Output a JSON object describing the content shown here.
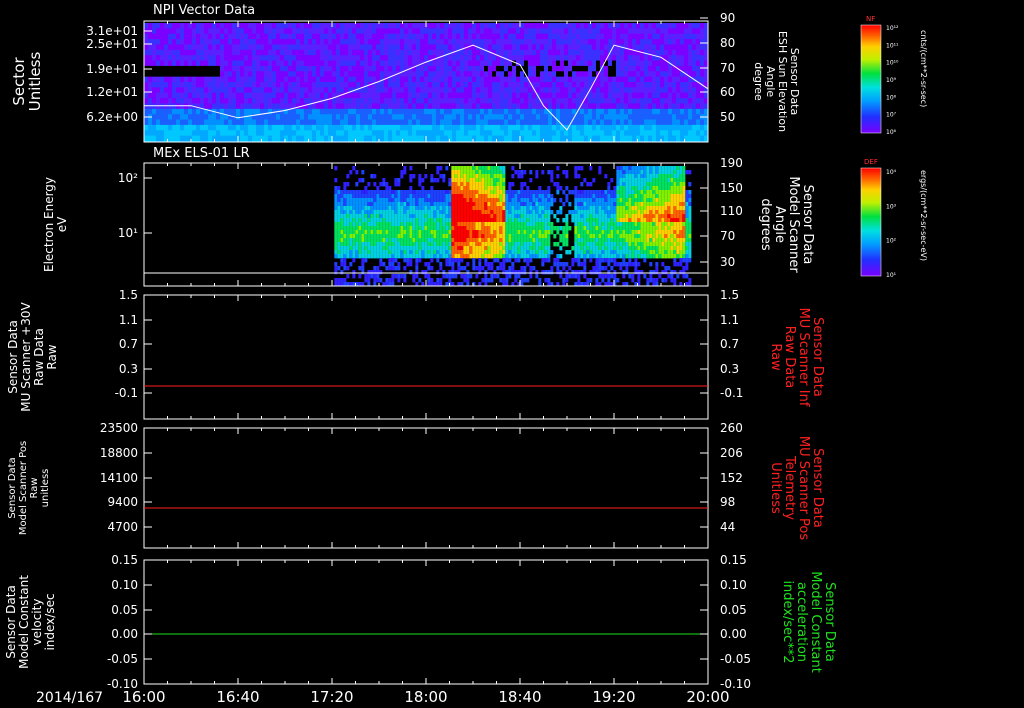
{
  "time_axis": {
    "date": "2014/167",
    "ticks": [
      "16:00",
      "16:40",
      "17:20",
      "18:00",
      "18:40",
      "19:20",
      "20:00"
    ]
  },
  "colors": {
    "white": "#ffffff",
    "red": "#ff2020",
    "green": "#20e020",
    "background": "#000000",
    "colorbar": [
      "#7a00ff",
      "#2030ff",
      "#00a0ff",
      "#00e0e0",
      "#00e040",
      "#c0f000",
      "#ffd000",
      "#ff6000",
      "#ff0000"
    ]
  },
  "panel1": {
    "title": "NPI Vector Data",
    "ylabel_left": [
      "Sector",
      "Unitless"
    ],
    "yticks_left": [
      "3.1e+01",
      "2.5e+01",
      "1.9e+01",
      "1.2e+01",
      "6.2e+00"
    ],
    "ylabel_right": [
      "Sensor Data",
      "ESH Sun Elevation",
      "Angle",
      "degree"
    ],
    "yticks_right": [
      "90",
      "80",
      "70",
      "60",
      "50"
    ],
    "colorbar": {
      "label": "NF",
      "units": "cnts/(cm**2-sr-sec)",
      "ticks": [
        "10¹²",
        "10¹¹",
        "10¹⁰",
        "10⁹",
        "10⁸",
        "10⁷",
        "10⁶"
      ]
    }
  },
  "panel2": {
    "title": "MEx ELS-01 LR",
    "ylabel_left": [
      "Electron Energy",
      "eV"
    ],
    "yticks_left": [
      "10²",
      "10¹"
    ],
    "ylabel_right": [
      "Sensor Data",
      "Model Scanner",
      "Angle",
      "degrees"
    ],
    "yticks_right": [
      "190",
      "150",
      "110",
      "70",
      "30"
    ],
    "colorbar": {
      "label": "DEF",
      "units": "ergs/(cm**2-sr-sec-eV)",
      "ticks": [
        "10⁴",
        "10³",
        "10²",
        "10¹"
      ]
    }
  },
  "panel3": {
    "ylabel_left": [
      "Sensor Data",
      "MU Scanner +30V",
      "Raw Data",
      "Raw"
    ],
    "yticks_left": [
      "1.5",
      "1.1",
      "0.7",
      "0.3",
      "-0.1"
    ],
    "ylabel_right": [
      "Sensor Data",
      "MU Scanner Inf",
      "Raw Data",
      "Raw"
    ],
    "yticks_right": [
      "1.5",
      "1.1",
      "0.7",
      "0.3",
      "-0.1"
    ]
  },
  "panel4": {
    "ylabel_left": [
      "Sensor Data",
      "Model Scanner Pos",
      "Raw",
      "unitless"
    ],
    "yticks_left": [
      "23500",
      "18800",
      "14100",
      "9400",
      "4700"
    ],
    "ylabel_right": [
      "Sensor Data",
      "MU Scanner Pos",
      "Telemetry",
      "Unitless"
    ],
    "yticks_right": [
      "260",
      "206",
      "152",
      "98",
      "44"
    ]
  },
  "panel5": {
    "ylabel_left": [
      "Sensor Data",
      "Model Constant",
      "velocity",
      "index/sec"
    ],
    "yticks_left": [
      "0.15",
      "0.10",
      "0.05",
      "0.00",
      "-0.05",
      "-0.10"
    ],
    "ylabel_right": [
      "Sensor Data",
      "Model Constant",
      "acceleration",
      "index/sec**2"
    ],
    "yticks_right": [
      "0.15",
      "0.10",
      "0.05",
      "0.00",
      "-0.05",
      "-0.10"
    ]
  },
  "chart_data": [
    {
      "type": "heatmap",
      "title": "NPI Vector Data",
      "x_range": [
        "16:00",
        "20:00"
      ],
      "ylabel": "Sector Unitless",
      "overlay_line": {
        "name": "ESH Sun Elevation Angle",
        "x": [
          "16:00",
          "16:20",
          "16:40",
          "17:00",
          "17:20",
          "17:40",
          "18:00",
          "18:20",
          "18:40",
          "18:50",
          "19:00",
          "19:10",
          "19:20",
          "19:40",
          "20:00"
        ],
        "y": [
          55,
          55,
          50,
          53,
          58,
          65,
          73,
          80,
          72,
          55,
          45,
          62,
          80,
          75,
          62
        ],
        "ylim": [
          40,
          90
        ]
      }
    },
    {
      "type": "heatmap",
      "title": "MEx ELS-01 LR",
      "x_range": [
        "16:00",
        "20:00"
      ],
      "ylabel": "Electron Energy eV",
      "overlay_line": {
        "name": "Model Scanner Angle",
        "y_constant": 10,
        "ylim": [
          -10,
          190
        ]
      }
    },
    {
      "type": "line",
      "series": [
        {
          "name": "MU Scanner +30V Raw Data",
          "y_constant": 0.0
        }
      ],
      "ylim": [
        -0.35,
        1.5
      ]
    },
    {
      "type": "line",
      "series": [
        {
          "name": "MU Scanner Pos Telemetry",
          "y_constant": 80
        }
      ],
      "ylim": [
        0,
        260
      ]
    },
    {
      "type": "line",
      "series": [
        {
          "name": "Model Constant velocity",
          "y_constant": 0.0
        },
        {
          "name": "Model Constant acceleration",
          "y_constant": 0.0
        }
      ],
      "ylim": [
        -0.1,
        0.15
      ]
    }
  ]
}
